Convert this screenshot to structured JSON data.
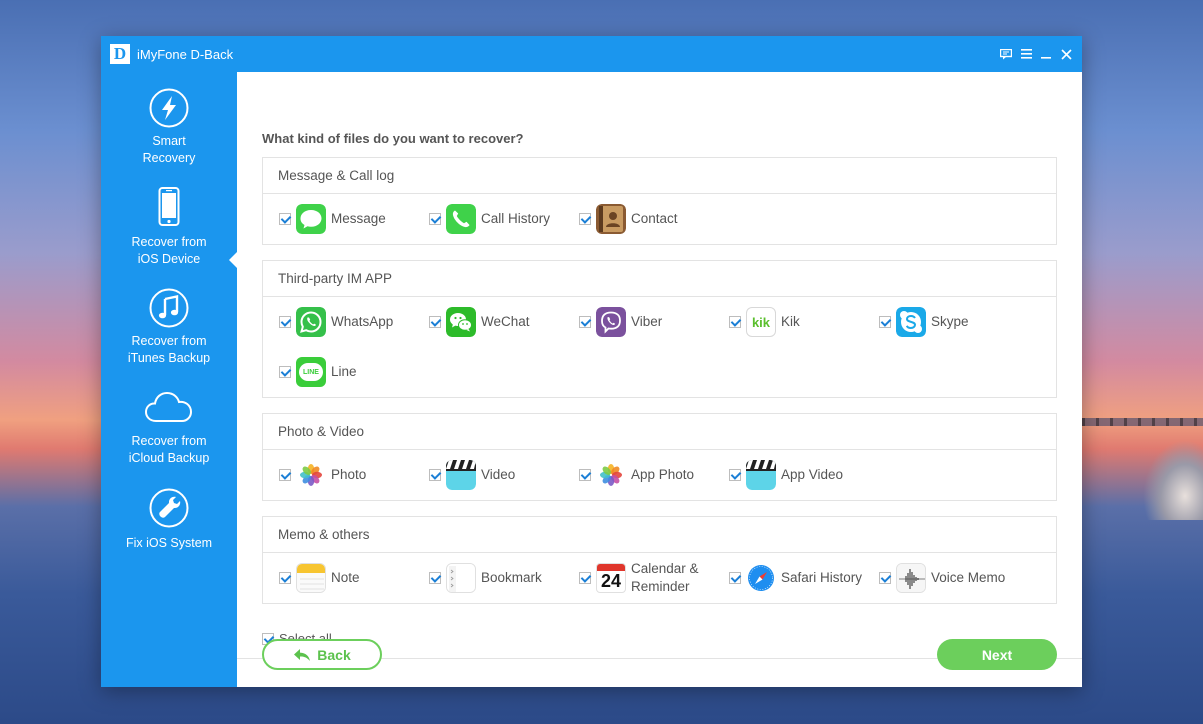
{
  "window": {
    "title": "iMyFone D-Back",
    "logo_letter": "D"
  },
  "sidebar": {
    "items": [
      {
        "label": "Smart\nRecovery",
        "icon": "lightning-icon"
      },
      {
        "label": "Recover from\niOS Device",
        "icon": "iphone-icon",
        "active": true
      },
      {
        "label": "Recover from\niTunes Backup",
        "icon": "music-note-icon"
      },
      {
        "label": "Recover from\niCloud Backup",
        "icon": "cloud-icon"
      },
      {
        "label": "Fix iOS System",
        "icon": "wrench-icon"
      }
    ]
  },
  "main": {
    "heading": "What kind of files do you want to recover?",
    "sections": [
      {
        "title": "Message & Call log",
        "items": [
          {
            "label": "Message",
            "icon": "message-icon",
            "checked": true
          },
          {
            "label": "Call History",
            "icon": "phone-icon",
            "checked": true
          },
          {
            "label": "Contact",
            "icon": "contacts-icon",
            "checked": true
          }
        ]
      },
      {
        "title": "Third-party IM APP",
        "items": [
          {
            "label": "WhatsApp",
            "icon": "whatsapp-icon",
            "checked": true
          },
          {
            "label": "WeChat",
            "icon": "wechat-icon",
            "checked": true
          },
          {
            "label": "Viber",
            "icon": "viber-icon",
            "checked": true
          },
          {
            "label": "Kik",
            "icon": "kik-icon",
            "checked": true,
            "icon_text": "kik"
          },
          {
            "label": "Skype",
            "icon": "skype-icon",
            "checked": true
          },
          {
            "label": "Line",
            "icon": "line-icon",
            "checked": true,
            "icon_text": "LINE"
          }
        ]
      },
      {
        "title": "Photo & Video",
        "items": [
          {
            "label": "Photo",
            "icon": "photos-icon",
            "checked": true
          },
          {
            "label": "Video",
            "icon": "video-clapper-icon",
            "checked": true
          },
          {
            "label": "App Photo",
            "icon": "photos-icon",
            "checked": true
          },
          {
            "label": "App Video",
            "icon": "video-clapper-icon",
            "checked": true
          }
        ]
      },
      {
        "title": "Memo & others",
        "items": [
          {
            "label": "Note",
            "icon": "notes-icon",
            "checked": true
          },
          {
            "label": "Bookmark",
            "icon": "bookmark-icon",
            "checked": true
          },
          {
            "label": "Calendar &\nReminder",
            "icon": "calendar-icon",
            "checked": true,
            "icon_text": "24"
          },
          {
            "label": "Safari History",
            "icon": "safari-compass-icon",
            "checked": true
          },
          {
            "label": "Voice Memo",
            "icon": "voice-memo-icon",
            "checked": true
          }
        ]
      }
    ],
    "select_all": {
      "label": "Select all",
      "checked": true
    }
  },
  "footer": {
    "back_label": "Back",
    "next_label": "Next"
  },
  "colors": {
    "accent": "#1b96ee",
    "green": "#6ccf5c",
    "text": "#555555"
  }
}
